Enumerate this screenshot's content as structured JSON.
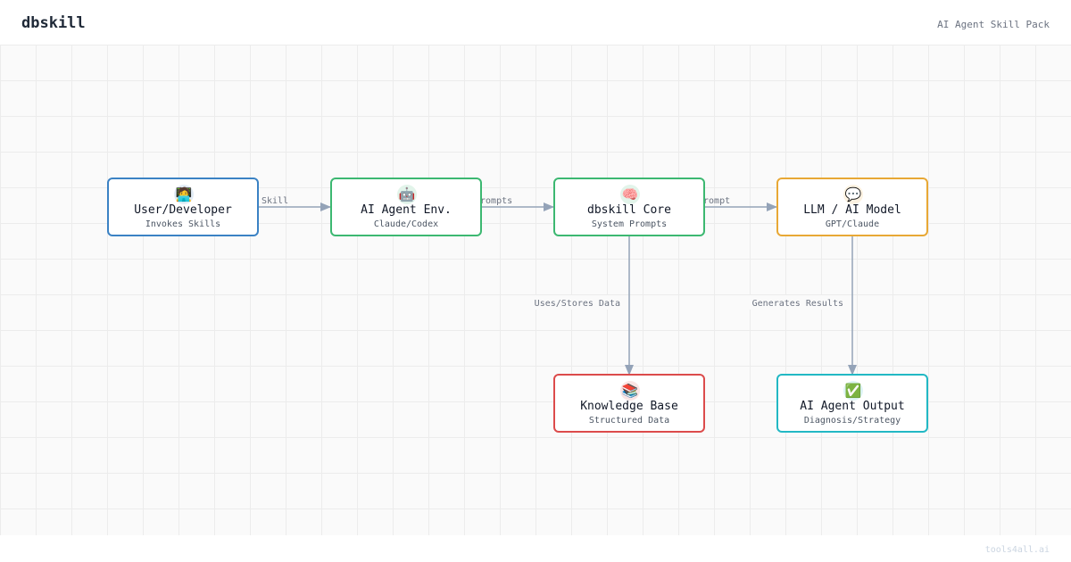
{
  "header": {
    "brand": "dbskill",
    "subtitle": "AI Agent Skill Pack"
  },
  "footer": {
    "credit": "tools4all.ai"
  },
  "nodes": {
    "user": {
      "title": "User/Developer",
      "desc": "Invokes Skills",
      "icon": "person-at-laptop-icon",
      "glyph": "🧑‍💻",
      "color": "#3b82c4"
    },
    "agent": {
      "title": "AI Agent Env.",
      "desc": "Claude/Codex",
      "icon": "robot-icon",
      "glyph": "🤖",
      "color": "#3cb871"
    },
    "core": {
      "title": "dbskill Core",
      "desc": "System Prompts",
      "icon": "brain-icon",
      "glyph": "🧠",
      "color": "#3cb871"
    },
    "llm": {
      "title": "LLM / AI Model",
      "desc": "GPT/Claude",
      "icon": "speech-bubble-icon",
      "glyph": "💬",
      "color": "#e8a835"
    },
    "kb": {
      "title": "Knowledge Base",
      "desc": "Structured Data",
      "icon": "books-icon",
      "glyph": "📚",
      "color": "#dc4b4b"
    },
    "output": {
      "title": "AI Agent Output",
      "desc": "Diagnosis/Strategy",
      "icon": "check-mark-icon",
      "glyph": "✅",
      "color": "#22b8c4"
    }
  },
  "edges": {
    "user_agent": "Skill",
    "agent_core": "Prompts",
    "core_llm": "Prompt",
    "core_kb": "Uses/Stores Data",
    "llm_output": "Generates Results"
  },
  "colors": {
    "edge": "#94a3b8"
  }
}
